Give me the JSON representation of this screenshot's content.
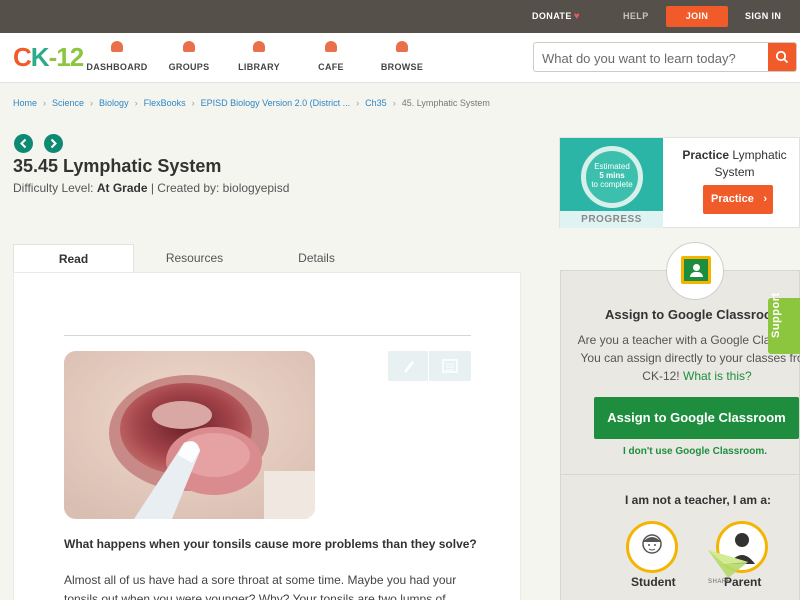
{
  "topbar": {
    "donate": "DONATE",
    "help": "HELP",
    "join": "JOIN",
    "signin": "SIGN IN"
  },
  "header": {
    "logo": {
      "c": "C",
      "k": "K",
      "dash": "-",
      "num": "12"
    },
    "nav": [
      {
        "label": "DASHBOARD",
        "icon": "dashboard-icon"
      },
      {
        "label": "GROUPS",
        "icon": "groups-icon"
      },
      {
        "label": "LIBRARY",
        "icon": "library-icon"
      },
      {
        "label": "CAFE",
        "icon": "cafe-icon"
      },
      {
        "label": "BROWSE",
        "icon": "browse-icon"
      }
    ],
    "search_placeholder": "What do you want to learn today?"
  },
  "breadcrumb": [
    "Home",
    "Science",
    "Biology",
    "FlexBooks",
    "EPISD Biology Version 2.0 (District ...",
    "Ch35",
    "45. Lymphatic System"
  ],
  "page": {
    "title": "35.45 Lymphatic System",
    "difficulty_label": "Difficulty Level:",
    "difficulty_value": "At Grade",
    "created_by": "| Created by: biologyepisd"
  },
  "tabs": [
    "Read",
    "Resources",
    "Details"
  ],
  "article": {
    "lead": "What happens when your tonsils cause more problems than they solve?",
    "paragraph": "Almost all of us have had a sore throat at some time. Maybe you had your tonsils out when you were younger? Why? Your tonsils are two lumps of"
  },
  "practice": {
    "estimated": "Estimated",
    "mins": "5 mins",
    "to_complete": "to complete",
    "progress": "PROGRESS",
    "title_bold": "Practice",
    "title_rest": "Lymphatic System",
    "button": "Practice"
  },
  "google": {
    "title": "Assign to Google Classroom",
    "text": "Are you a teacher with a Google Classroom? You can assign directly to your classes from CK-12!",
    "link": "What is this?",
    "button": "Assign to Google Classroom",
    "no_use": "I don't use Google Classroom.",
    "role_prompt": "I am not a teacher, I am a:",
    "student": "Student",
    "parent": "Parent"
  },
  "share": "SHARE",
  "support": "Support",
  "colors": {
    "accent": "#f15a29",
    "teal": "#0e8a74",
    "google_green": "#1e8e3e",
    "support_green": "#8cc63f"
  }
}
